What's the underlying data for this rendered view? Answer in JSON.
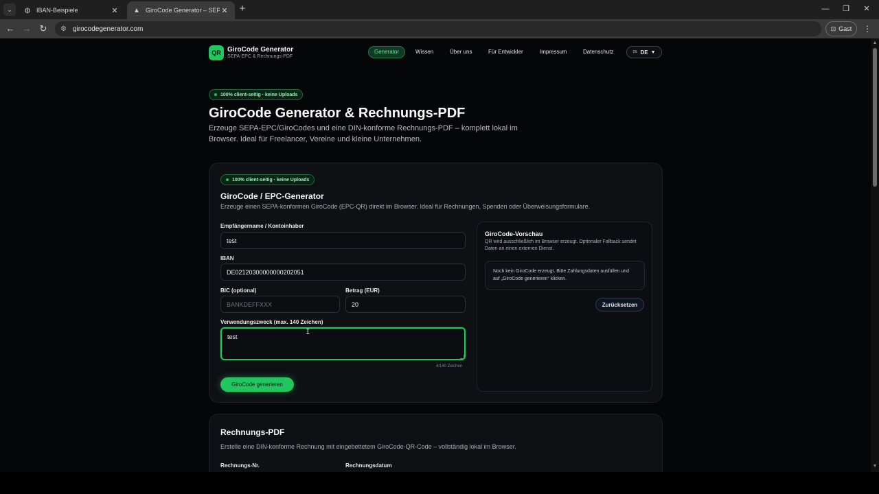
{
  "browser": {
    "tabs": [
      {
        "title": "IBAN-Beispiele",
        "icon": "globe-icon",
        "active": false
      },
      {
        "title": "GiroCode Generator – SEPA-QR",
        "icon": "triangle-logo-icon",
        "active": true
      }
    ],
    "url": "girocodegenerator.com",
    "profile_label": "Gast"
  },
  "site": {
    "logo_text": "QR",
    "brand_name": "GiroCode Generator",
    "brand_sub": "SEPA-EPC & Rechnungs-PDF",
    "nav": [
      {
        "label": "Generator",
        "active": true
      },
      {
        "label": "Wissen"
      },
      {
        "label": "Über uns"
      },
      {
        "label": "Für Entwickler"
      },
      {
        "label": "Impressum"
      },
      {
        "label": "Datenschutz"
      }
    ],
    "lang": {
      "flag": "DE",
      "label": "DE"
    }
  },
  "hero": {
    "badge": "100% client-seitig · keine Uploads",
    "title": "GiroCode Generator & Rechnungs-PDF",
    "description": "Erzeuge SEPA-EPC/GiroCodes und eine DIN-konforme Rechnungs-PDF – komplett lokal im Browser. Ideal für Freelancer, Vereine und kleine Unternehmen."
  },
  "generator": {
    "badge": "100% client-seitig · keine Uploads",
    "title": "GiroCode / EPC-Generator",
    "description": "Erzeuge einen SEPA-konformen GiroCode (EPC-QR) direkt im Browser. Ideal für Rechnungen, Spenden oder Überweisungsformulare.",
    "fields": {
      "name": {
        "label": "Empfängername / Kontoinhaber",
        "value": "test"
      },
      "iban": {
        "label": "IBAN",
        "value": "DE02120300000000202051"
      },
      "bic": {
        "label": "BIC (optional)",
        "value": "",
        "placeholder": "BANKDEFFXXX"
      },
      "amount": {
        "label": "Betrag (EUR)",
        "value": "20"
      },
      "purpose": {
        "label": "Verwendungszweck (max. 140 Zeichen)",
        "value": "test",
        "counter": "4/140 Zeichen"
      }
    },
    "submit_label": "GiroCode generieren",
    "preview": {
      "title": "GiroCode-Vorschau",
      "description": "QR wird ausschließlich im Browser erzeugt. Optionaler Fallback sendet Daten an einen externen Dienst.",
      "empty_text": "Noch kein GiroCode erzeugt. Bitte Zahlungsdaten ausfüllen und auf „GiroCode generieren“ klicken.",
      "reset_label": "Zurücksetzen"
    }
  },
  "invoice": {
    "title": "Rechnungs-PDF",
    "description": "Erstelle eine DIN-konforme Rechnung mit eingebettetem GiroCode-QR-Code – vollständig lokal im Browser.",
    "fields": {
      "number_label": "Rechnungs-Nr.",
      "date_label": "Rechnungsdatum"
    }
  }
}
